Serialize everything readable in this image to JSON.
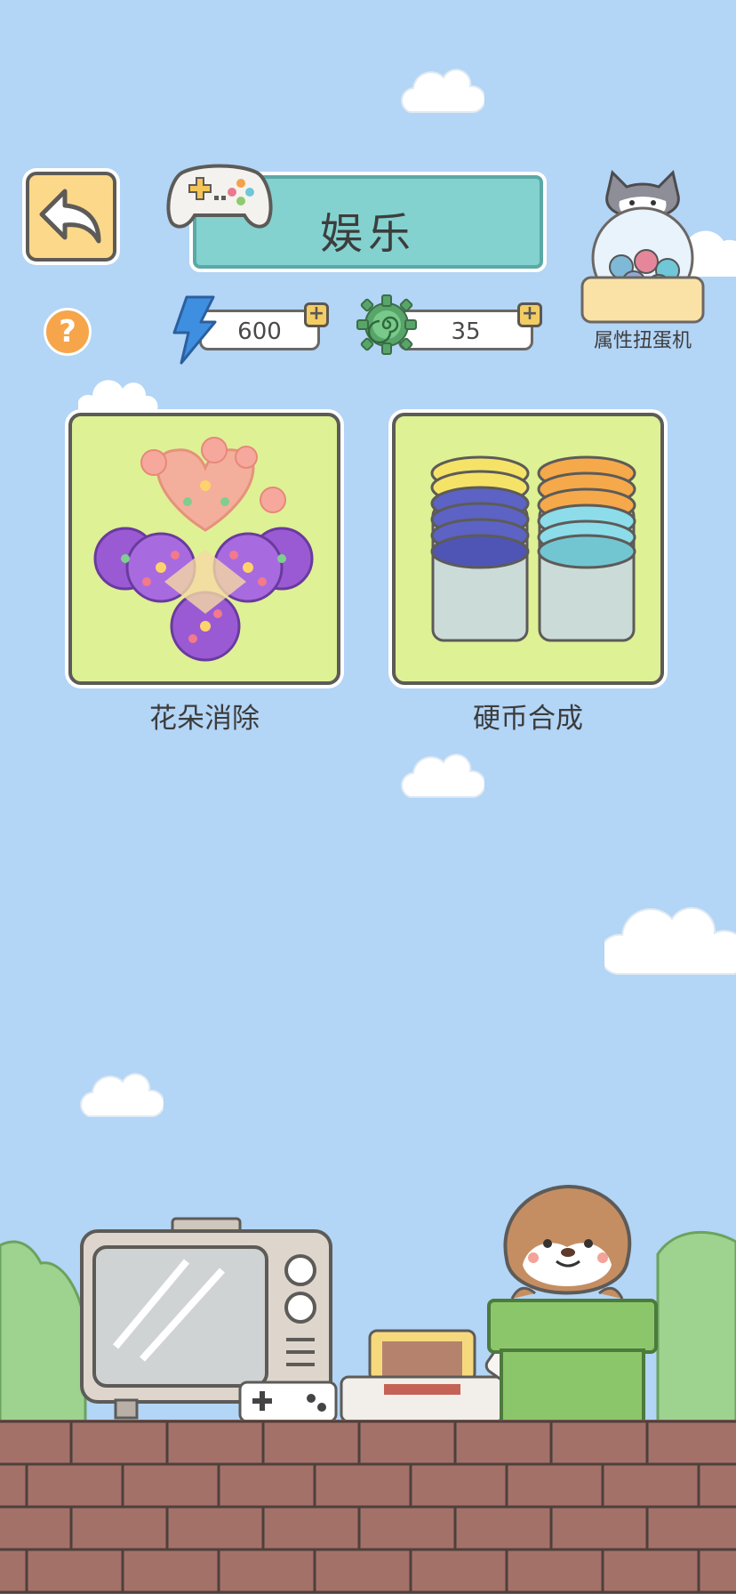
{
  "header": {
    "title": "娱乐",
    "back_icon": "back-arrow-icon",
    "title_icon": "gamepad-icon"
  },
  "resources": {
    "energy": {
      "icon": "lightning-icon",
      "value": "600",
      "color": "#3f8fe0"
    },
    "spiral": {
      "icon": "green-gear-spiral-icon",
      "value": "35",
      "color": "#58a56a"
    }
  },
  "help": {
    "icon": "question-icon",
    "label": "?"
  },
  "gacha": {
    "label": "属性扭蛋机",
    "icon": "gacha-machine-icon"
  },
  "games": [
    {
      "label": "花朵消除",
      "icon": "flower-match-icon"
    },
    {
      "label": "硬币合成",
      "icon": "coin-stack-icon"
    }
  ],
  "colors": {
    "sky": "#b3d5f6",
    "card_bg": "#def194",
    "banner": "#83d2cf",
    "back_button": "#fcd88a",
    "brick": "#a47169"
  }
}
